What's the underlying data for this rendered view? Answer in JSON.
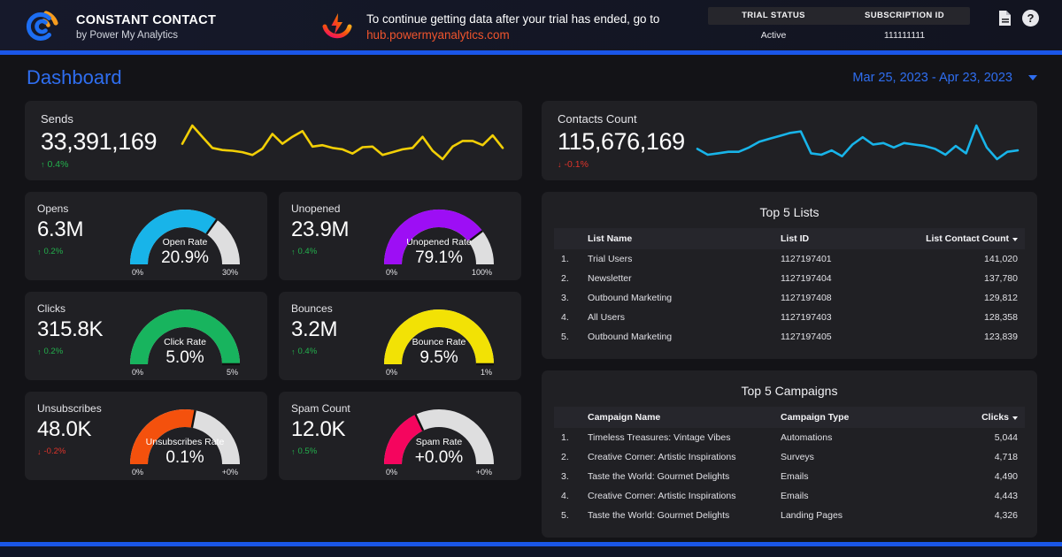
{
  "header": {
    "brand_title": "CONSTANT CONTACT",
    "brand_sub": "by Power My Analytics",
    "logo_icon": "constant-contact-logo",
    "pma_icon": "power-my-analytics-logo",
    "trial_message": "To continue getting data after your trial has ended, go to",
    "trial_link": "hub.powermyanalytics.com",
    "status": {
      "col1_label": "TRIAL STATUS",
      "col2_label": "SUBSCRIPTION ID",
      "col1_value": "Active",
      "col2_value": "111111111"
    },
    "doc_icon": "document-icon",
    "help_icon": "help-circle-icon",
    "help_glyph": "?",
    "accent_color": "#1a56e8"
  },
  "title_bar": {
    "title": "Dashboard",
    "date_range": "Mar 25, 2023 - Apr 23, 2023",
    "caret_icon": "chevron-down-icon"
  },
  "metrics": {
    "sends": {
      "label": "Sends",
      "value": "33,391,169",
      "delta": "0.4%",
      "direction": "up",
      "arrow": "↑",
      "color": "#f2cf06"
    },
    "contacts": {
      "label": "Contacts Count",
      "value": "115,676,169",
      "delta": "-0.1%",
      "direction": "down",
      "arrow": "↓",
      "color": "#18b4e9"
    }
  },
  "gauges": [
    {
      "label": "Opens",
      "value": "6.3M",
      "delta": "0.2%",
      "direction": "up",
      "arrow": "↑",
      "rate_title": "Open Rate",
      "rate_value": "20.9%",
      "min": "0%",
      "max": "30%",
      "fill_fraction": 0.697,
      "color": "#18b4e9"
    },
    {
      "label": "Unopened",
      "value": "23.9M",
      "delta": "0.4%",
      "direction": "up",
      "arrow": "↑",
      "rate_title": "Unopened Rate",
      "rate_value": "79.1%",
      "min": "0%",
      "max": "100%",
      "fill_fraction": 0.791,
      "color": "#9d0ef5"
    },
    {
      "label": "Clicks",
      "value": "315.8K",
      "delta": "0.2%",
      "direction": "up",
      "arrow": "↑",
      "rate_title": "Click Rate",
      "rate_value": "5.0%",
      "min": "0%",
      "max": "5%",
      "fill_fraction": 1.0,
      "color": "#18b45e"
    },
    {
      "label": "Bounces",
      "value": "3.2M",
      "delta": "0.4%",
      "direction": "up",
      "arrow": "↑",
      "rate_title": "Bounce Rate",
      "rate_value": "9.5%",
      "min": "0%",
      "max": "1%",
      "fill_fraction": 1.0,
      "color": "#f2e205"
    },
    {
      "label": "Unsubscribes",
      "value": "48.0K",
      "delta": "-0.2%",
      "direction": "down",
      "arrow": "↓",
      "rate_title": "Unsubscribes Rate",
      "rate_value": "0.1%",
      "min": "0%",
      "max": "+0%",
      "fill_fraction": 0.56,
      "color": "#f4510d"
    },
    {
      "label": "Spam Count",
      "value": "12.0K",
      "delta": "0.5%",
      "direction": "up",
      "arrow": "↑",
      "rate_title": "Spam Rate",
      "rate_value": "+0.0%",
      "min": "0%",
      "max": "+0%",
      "fill_fraction": 0.36,
      "color": "#f5055e"
    }
  ],
  "top_lists": {
    "title": "Top 5 Lists",
    "columns": [
      "List Name",
      "List ID",
      "List Contact Count"
    ],
    "rows": [
      {
        "rank": "1.",
        "name": "Trial Users",
        "id": "1127197401",
        "count": "141,020"
      },
      {
        "rank": "2.",
        "name": "Newsletter",
        "id": "1127197404",
        "count": "137,780"
      },
      {
        "rank": "3.",
        "name": "Outbound Marketing",
        "id": "1127197408",
        "count": "129,812"
      },
      {
        "rank": "4.",
        "name": "All Users",
        "id": "1127197403",
        "count": "128,358"
      },
      {
        "rank": "5.",
        "name": "Outbound Marketing",
        "id": "1127197405",
        "count": "123,839"
      }
    ]
  },
  "top_campaigns": {
    "title": "Top 5 Campaigns",
    "columns": [
      "Campaign Name",
      "Campaign Type",
      "Clicks"
    ],
    "rows": [
      {
        "rank": "1.",
        "name": "Timeless Treasures: Vintage Vibes",
        "type": "Automations",
        "clicks": "5,044"
      },
      {
        "rank": "2.",
        "name": "Creative Corner: Artistic Inspirations",
        "type": "Surveys",
        "clicks": "4,718"
      },
      {
        "rank": "3.",
        "name": "Taste the World: Gourmet Delights",
        "type": "Emails",
        "clicks": "4,490"
      },
      {
        "rank": "4.",
        "name": "Creative Corner: Artistic Inspirations",
        "type": "Emails",
        "clicks": "4,443"
      },
      {
        "rank": "5.",
        "name": "Taste the World: Gourmet Delights",
        "type": "Landing Pages",
        "clicks": "4,326"
      }
    ]
  },
  "chart_data": [
    {
      "type": "line",
      "title": "Sends",
      "name": "sends-sparkline",
      "color": "#f2cf06",
      "ylabel": "",
      "xlabel": "",
      "values": [
        52,
        78,
        62,
        46,
        43,
        42,
        40,
        36,
        45,
        66,
        52,
        62,
        70,
        48,
        50,
        46,
        44,
        38,
        47,
        48,
        36,
        40,
        44,
        46,
        62,
        42,
        30,
        48,
        56,
        56,
        50,
        64,
        46
      ]
    },
    {
      "type": "line",
      "title": "Contacts Count",
      "name": "contacts-sparkline",
      "color": "#18b4e9",
      "ylabel": "",
      "xlabel": "",
      "values": [
        50,
        42,
        44,
        46,
        46,
        52,
        60,
        64,
        68,
        72,
        74,
        44,
        42,
        48,
        40,
        56,
        66,
        56,
        58,
        52,
        58,
        56,
        54,
        50,
        42,
        54,
        44,
        82,
        52,
        36,
        46,
        48
      ]
    }
  ]
}
